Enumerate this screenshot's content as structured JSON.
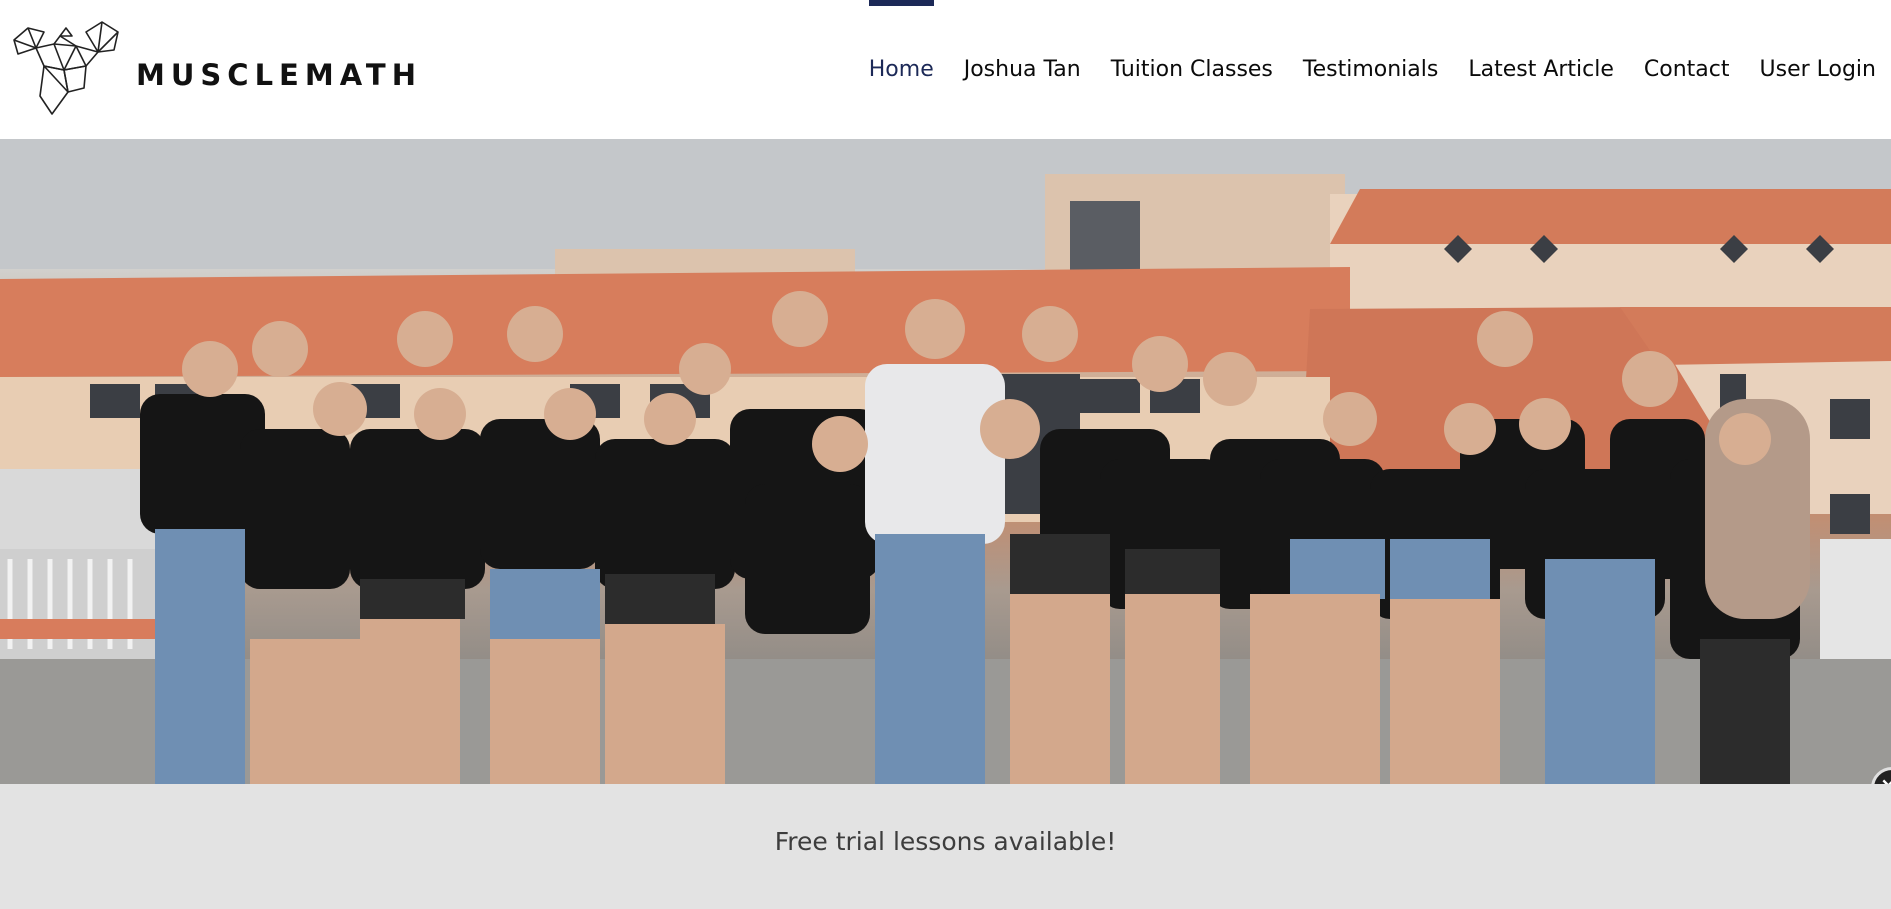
{
  "brand": {
    "name": "MUSCLEMATH",
    "logo_icon": "geometric-flexing-figure-icon"
  },
  "nav": {
    "items": [
      {
        "label": "Home",
        "active": true
      },
      {
        "label": "Joshua Tan",
        "active": false
      },
      {
        "label": "Tuition Classes",
        "active": false
      },
      {
        "label": "Testimonials",
        "active": false
      },
      {
        "label": "Latest Article",
        "active": false
      },
      {
        "label": "Contact",
        "active": false
      },
      {
        "label": "User Login",
        "active": false
      }
    ],
    "active_color": "#1c2957"
  },
  "hero": {
    "image_alt": ""
  },
  "close_badge": {
    "icon": "close-icon",
    "glyph": "×"
  },
  "banner": {
    "text": "Free trial lessons available!"
  }
}
